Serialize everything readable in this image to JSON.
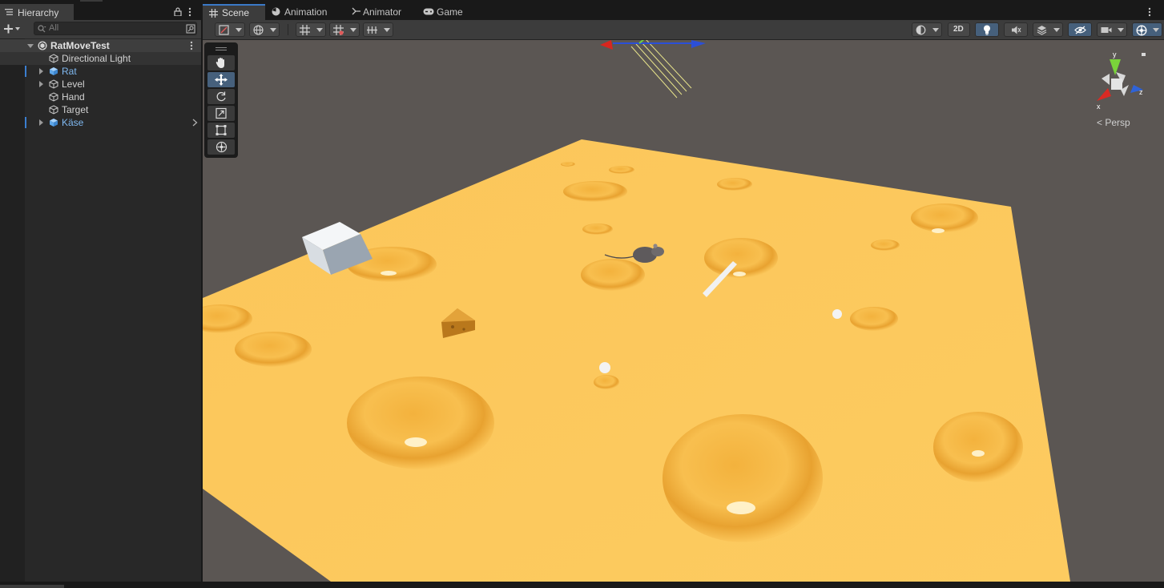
{
  "hierarchy": {
    "tab_label": "Hierarchy",
    "search_placeholder": "All",
    "scene_name": "RatMoveTest",
    "items": [
      {
        "label": "Directional Light",
        "prefab": false,
        "expandable": false
      },
      {
        "label": "Rat",
        "prefab": true,
        "expandable": true
      },
      {
        "label": "Level",
        "prefab": false,
        "expandable": true
      },
      {
        "label": "Hand",
        "prefab": false,
        "expandable": false
      },
      {
        "label": "Target",
        "prefab": false,
        "expandable": false
      },
      {
        "label": "Käse",
        "prefab": true,
        "expandable": true
      }
    ]
  },
  "scene_view": {
    "tabs": [
      {
        "label": "Scene",
        "icon": "grid-icon"
      },
      {
        "label": "Animation",
        "icon": "clock-icon"
      },
      {
        "label": "Animator",
        "icon": "animator-icon"
      },
      {
        "label": "Game",
        "icon": "gamepad-icon"
      }
    ],
    "toggle_2d_label": "2D",
    "projection_label": "Persp",
    "gizmo_axes": {
      "x": "x",
      "y": "y",
      "z": "z"
    }
  },
  "colors": {
    "accent": "#3a79c7",
    "prefab_text": "#7fb8f0",
    "cheese": "#fbc65a",
    "background_3d": "#5b5653"
  }
}
